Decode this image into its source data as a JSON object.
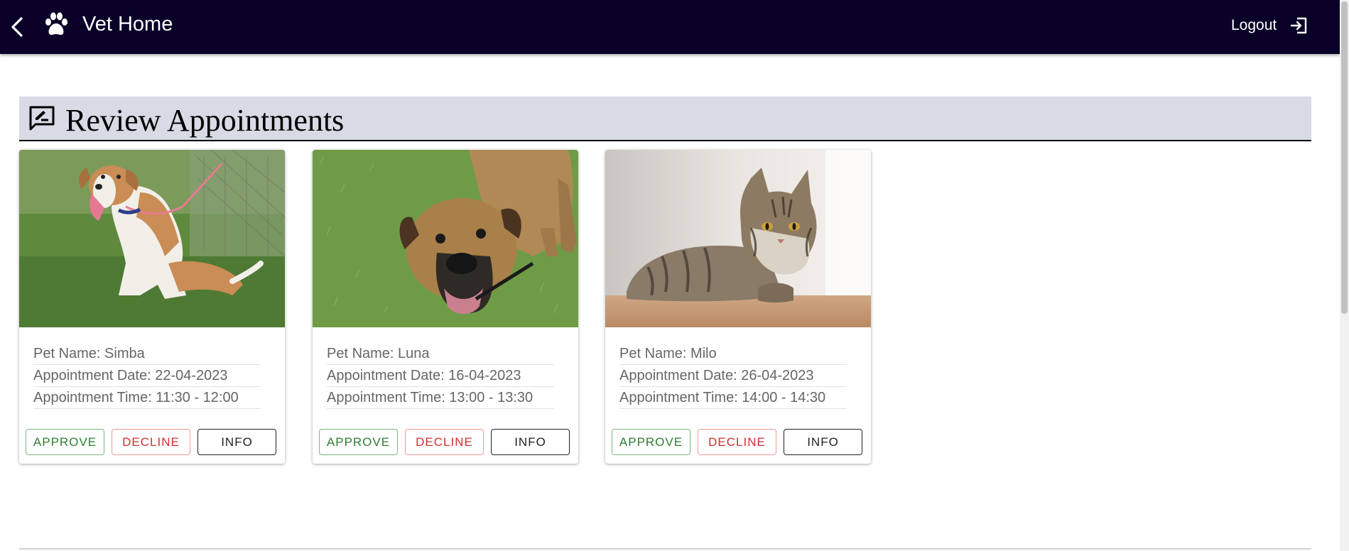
{
  "appbar": {
    "title": "Vet Home",
    "logout_label": "Logout",
    "background": "#0b0028"
  },
  "section": {
    "title": "Review Appointments",
    "background": "#d8dbe6"
  },
  "buttons": {
    "approve": "APPROVE",
    "decline": "DECLINE",
    "info": "INFO"
  },
  "appointments": [
    {
      "pet_name": "Pet Name: Simba",
      "date": "Appointment Date: 22-04-2023",
      "time": "Appointment Time: 11:30 - 12:00",
      "photo": "dog-simba-photo"
    },
    {
      "pet_name": "Pet Name: Luna",
      "date": "Appointment Date: 16-04-2023",
      "time": "Appointment Time: 13:00 - 13:30",
      "photo": "dog-luna-photo"
    },
    {
      "pet_name": "Pet Name: Milo",
      "date": "Appointment Date: 26-04-2023",
      "time": "Appointment Time: 14:00 - 14:30",
      "photo": "cat-milo-photo"
    }
  ],
  "colors": {
    "approve": "#2e7d32",
    "decline": "#d32f2f",
    "info": "#222222"
  }
}
